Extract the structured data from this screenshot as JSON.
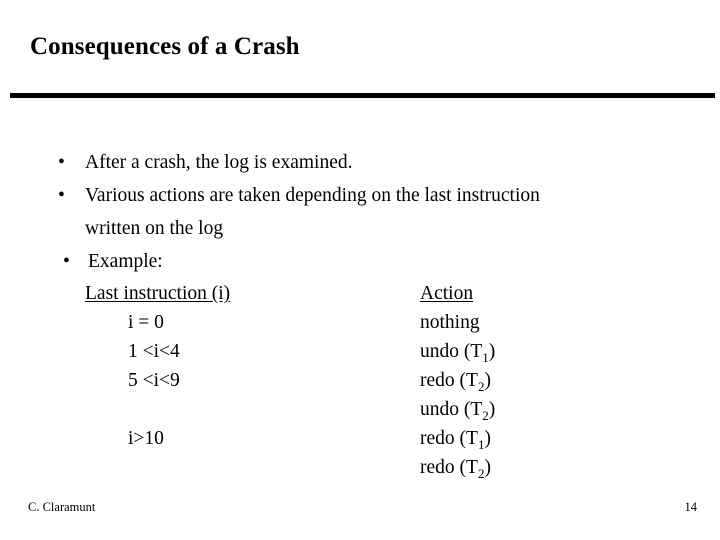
{
  "slide": {
    "title": "Consequences of a Crash",
    "bullet_char": "•",
    "bullets": [
      {
        "text": "After a crash, the log is examined."
      },
      {
        "text": "Various actions are taken depending on the last instruction",
        "continuation": "written on the log"
      },
      {
        "text": "Example:"
      }
    ],
    "example": {
      "header_left": "Last instruction (i)",
      "header_right": "Action",
      "rows": [
        {
          "condition": "i = 0",
          "action_verb": "nothing",
          "action_sub": ""
        },
        {
          "condition": "1 <i<4",
          "action_verb": "undo (T",
          "action_sub": "1"
        },
        {
          "condition": "5 <i<9",
          "action_verb": "redo (T",
          "action_sub": "2"
        },
        {
          "condition": "",
          "action_verb": "undo (T",
          "action_sub": "2"
        },
        {
          "condition": "i>10",
          "action_verb": "redo (T",
          "action_sub": "1"
        },
        {
          "condition": "",
          "action_verb": "redo (T",
          "action_sub": "2"
        }
      ],
      "action_close": ")"
    },
    "footer": {
      "author": "C. Claramunt",
      "page_number": "14"
    },
    "colors": {
      "background": "#ffffff",
      "text": "#000000",
      "rule": "#000000"
    }
  }
}
